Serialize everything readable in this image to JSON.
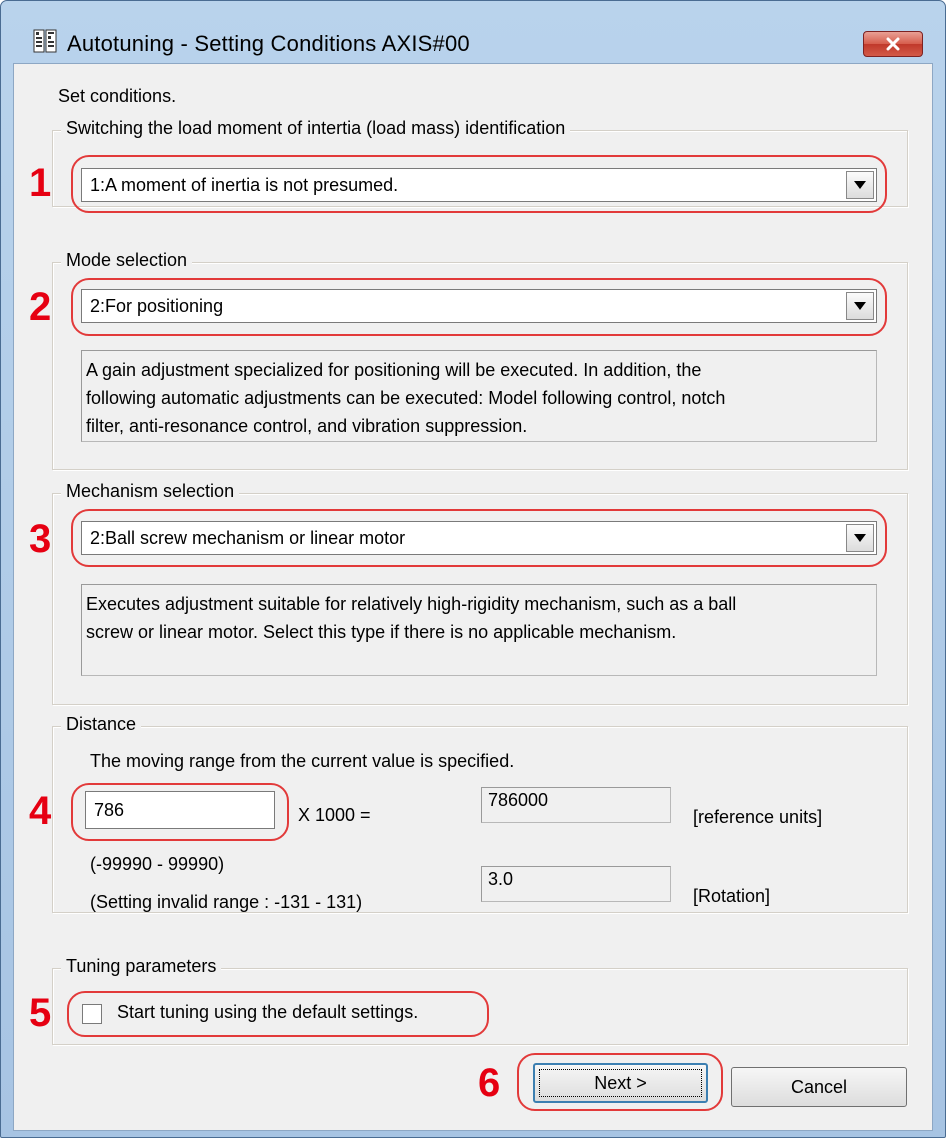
{
  "window": {
    "title": "Autotuning - Setting Conditions AXIS#00",
    "icon": "autotuning-app-icon",
    "close_icon": "close-icon"
  },
  "caption": "Set conditions.",
  "groups": {
    "load_inertia": {
      "title": "Switching the load moment of intertia (load mass) identification",
      "selected": "1:A moment of inertia is not presumed."
    },
    "mode": {
      "title": "Mode selection",
      "selected": "2:For positioning",
      "description": [
        "A gain adjustment specialized for positioning will be executed. In addition, the",
        "following automatic adjustments can be executed: Model following control, notch",
        "filter, anti-resonance control, and vibration suppression."
      ]
    },
    "mechanism": {
      "title": "Mechanism selection",
      "selected": "2:Ball screw mechanism or linear motor",
      "description": [
        "Executes adjustment suitable for relatively high-rigidity mechanism, such as a ball",
        "screw or linear motor. Select this type if there is no applicable mechanism."
      ]
    },
    "distance": {
      "title": "Distance",
      "instruction": "The moving range from the current value is specified.",
      "input_value": "786",
      "multiplier": "X 1000 =",
      "result_value": "786000",
      "result_unit": "[reference units]",
      "range": "(-99990 - 99990)",
      "invalid_range": "(Setting invalid range : -131 - 131)",
      "rotation_value": "3.0",
      "rotation_unit": "[Rotation]"
    },
    "tuning": {
      "title": "Tuning parameters",
      "checkbox_label": "Start tuning using the default settings.",
      "checked": false
    }
  },
  "buttons": {
    "next": "Next >",
    "cancel": "Cancel"
  },
  "markers": [
    "1",
    "2",
    "3",
    "4",
    "5",
    "6"
  ],
  "colors": {
    "marker": "#e60012",
    "highlight": "#e23a3a",
    "titlebar": "#b9d3ec",
    "close_button": "#c0392b"
  }
}
